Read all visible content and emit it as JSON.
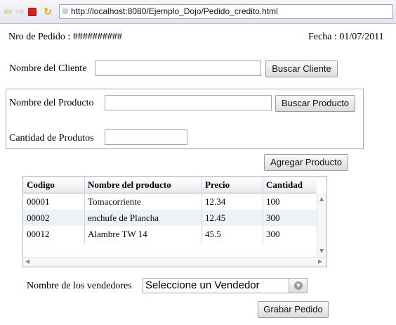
{
  "browser": {
    "url": "http://localhost:8080/Ejemplo_Dojo/Pedido_credito.html"
  },
  "order": {
    "number_label": "Nro de Pedido : ##########",
    "date_label": "Fecha : 01/07/2011"
  },
  "client": {
    "label": "Nombre del Cliente",
    "value": "",
    "button": "Buscar Cliente"
  },
  "product": {
    "label": "Nombre del Producto",
    "value": "",
    "button": "Buscar Producto",
    "quantity_label": "Cantidad de Produtos",
    "quantity_value": ""
  },
  "add_button": "Agregar Producto",
  "grid": {
    "columns": [
      "Codigo",
      "Nombre del producto",
      "Precio",
      "Cantidad"
    ],
    "rows": [
      [
        "00001",
        "Tomacorriente",
        "12.34",
        "100"
      ],
      [
        "00002",
        "enchufe de Plancha",
        "12.45",
        "300"
      ],
      [
        "00012",
        "Alambre TW 14",
        "45.5",
        "300"
      ]
    ]
  },
  "vendors": {
    "label": "Nombre de los vendedores",
    "selected": "Seleccione un Vendedor"
  },
  "save_button": "Grabar Pedido"
}
